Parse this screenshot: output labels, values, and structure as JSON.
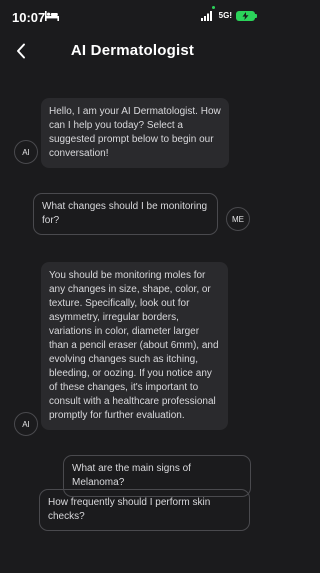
{
  "status_bar": {
    "time": "10:07",
    "network": "5G!"
  },
  "header": {
    "title": "AI Dermatologist"
  },
  "messages": [
    {
      "sender": "AI",
      "text": "Hello, I am your AI Dermatologist. How can I help you today? Select a suggested prompt below to begin our conversation!"
    },
    {
      "sender": "ME",
      "text": "What changes should I be monitoring for?"
    },
    {
      "sender": "AI",
      "text": "You should be monitoring moles for any changes in size, shape, color, or texture. Specifically, look out for asymmetry, irregular borders, variations in color, diameter larger than a pencil eraser (about 6mm), and evolving changes such as itching, bleeding, or oozing. If you notice any of these changes, it's important to consult with a healthcare professional promptly for further evaluation."
    }
  ],
  "suggestions": [
    "What are the main signs of Melanoma?",
    "How frequently should I perform skin checks?"
  ]
}
